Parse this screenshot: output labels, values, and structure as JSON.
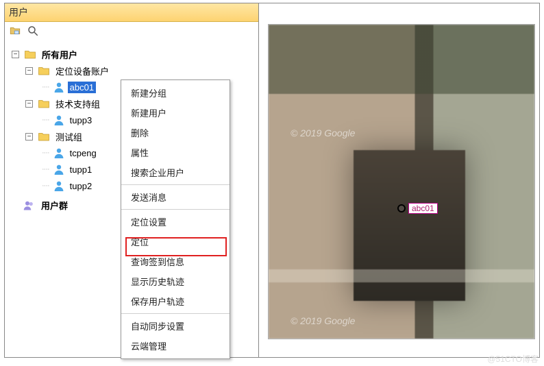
{
  "panel": {
    "title": "用户"
  },
  "tree": {
    "root": {
      "label": "所有用户"
    },
    "group1": {
      "label": "定位设备账户"
    },
    "user1": {
      "label": "abc01"
    },
    "group2": {
      "label": "技术支持组"
    },
    "user2": {
      "label": "tupp3"
    },
    "group3": {
      "label": "测试组"
    },
    "user3": {
      "label": "tcpeng"
    },
    "user4": {
      "label": "tupp1"
    },
    "user5": {
      "label": "tupp2"
    },
    "usergroups": {
      "label": "用户群"
    }
  },
  "menu": {
    "new_group": "新建分组",
    "new_user": "新建用户",
    "delete": "删除",
    "properties": "属性",
    "search_ent": "搜索企业用户",
    "send_msg": "发送消息",
    "locate_cfg": "定位设置",
    "locate": "定位",
    "query_checkin": "查询签到信息",
    "show_history": "显示历史轨迹",
    "save_track": "保存用户轨迹",
    "auto_sync": "自动同步设置",
    "cloud_mgmt": "云端管理"
  },
  "map": {
    "marker_label": "abc01",
    "watermark1": "© 2019 Google",
    "watermark2": "© 2019 Google"
  },
  "watermark": "@51CTO博客"
}
